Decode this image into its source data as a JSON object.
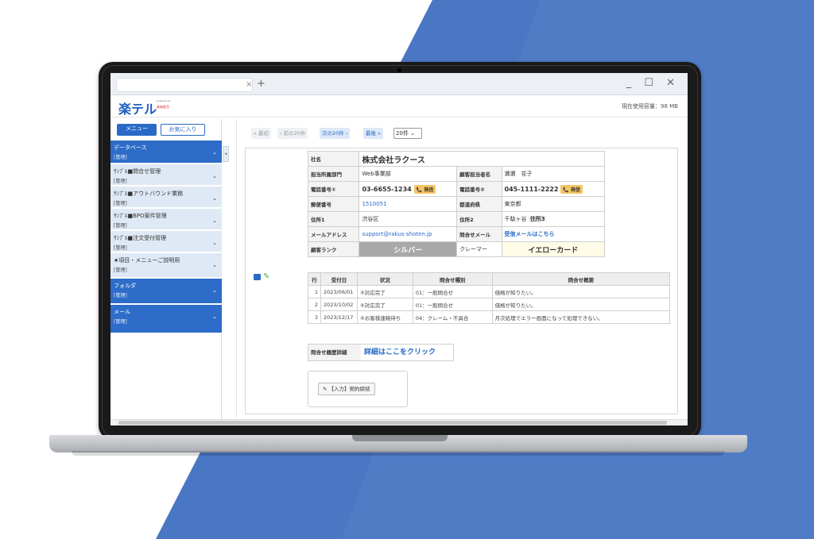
{
  "colors": {
    "background_blue": "#4a77c4",
    "accent": "#2a6ac7",
    "call_button": "#f4c462"
  },
  "browser": {
    "close_tab": "×",
    "new_tab": "+",
    "window_controls": "_ ☐ ✕"
  },
  "app": {
    "logo_text": "楽テル",
    "logo_powered": "powered by",
    "logo_badge": "楽楽販売",
    "usage_label": "現在使用容量：98 MB"
  },
  "sidebar": {
    "tabs": {
      "menu": "メニュー",
      "favorites": "お気に入り"
    },
    "items": [
      {
        "label": "データベース",
        "sub": "[管理]",
        "style": "dark"
      },
      {
        "label": "ｻﾝﾌﾟﾙ■問合せ管理",
        "sub": "[管理]",
        "style": "light"
      },
      {
        "label": "ｻﾝﾌﾟﾙ■アウトバウンド業務",
        "sub": "[管理]",
        "style": "light"
      },
      {
        "label": "ｻﾝﾌﾟﾙ■BPO案件管理",
        "sub": "[管理]",
        "style": "light"
      },
      {
        "label": "ｻﾝﾌﾟﾙ■注文受付管理",
        "sub": "[管理]",
        "style": "light"
      },
      {
        "label": "★項目・メニューご説明用",
        "sub": "[管理]",
        "style": "light"
      },
      {
        "label": "フォルダ",
        "sub": "[管理]",
        "style": "dark"
      },
      {
        "label": "メール",
        "sub": "[管理]",
        "style": "dark"
      }
    ]
  },
  "pager": {
    "first": "« 最初",
    "prev": "‹ 前の20件",
    "next": "次の20件 ›",
    "last": "最後 »",
    "per_page": "20件"
  },
  "record": {
    "company_label": "社名",
    "company_value": "株式会社ラクース",
    "dept_label": "担当所属部門",
    "dept_value": "Web事業部",
    "contact_label": "顧客担当者名",
    "contact_value": "瀬瀬　花子",
    "phone1_label": "電話番号①",
    "phone1_value": "03-6655-1234",
    "phone2_label": "電話番号②",
    "phone2_value": "045-1111-2222",
    "call_label": "発信",
    "zip_label": "郵便番号",
    "zip_value": "1510051",
    "pref_label": "都道府県",
    "pref_value": "東京都",
    "addr1_label": "住所1",
    "addr1_value": "渋谷区",
    "addr2_label": "住所2",
    "addr2_value": "千駄ヶ谷",
    "addr3_label": "住所3",
    "mail_label": "メールアドレス",
    "mail_value": "support@rakus-shoten.jp",
    "inquiry_mail_label": "問合せメール",
    "inquiry_mail_value": "受信メールはこちら",
    "rank_label": "顧客ランク",
    "rank_value": "シルバー",
    "claimer_label": "クレーマー",
    "claimer_value": "イエローカード"
  },
  "history": {
    "headers": [
      "行",
      "受付日",
      "状況",
      "問合せ種別",
      "問合せ概要"
    ],
    "rows": [
      [
        "1",
        "2023/06/01",
        "⑤対応完了",
        "01：一般問合せ",
        "価格が知りたい。"
      ],
      [
        "2",
        "2023/10/02",
        "⑤対応完了",
        "01：一般問合せ",
        "価格が知りたい。"
      ],
      [
        "3",
        "2023/12/17",
        "④お客様連絡待ち",
        "04：クレーム・不具合",
        "月次処理でエラー画面になって処理できない。"
      ]
    ]
  },
  "detail": {
    "label": "問合せ履歴詳細",
    "link": "詳細はここをクリック"
  },
  "input_button": "【入力】契約締結"
}
